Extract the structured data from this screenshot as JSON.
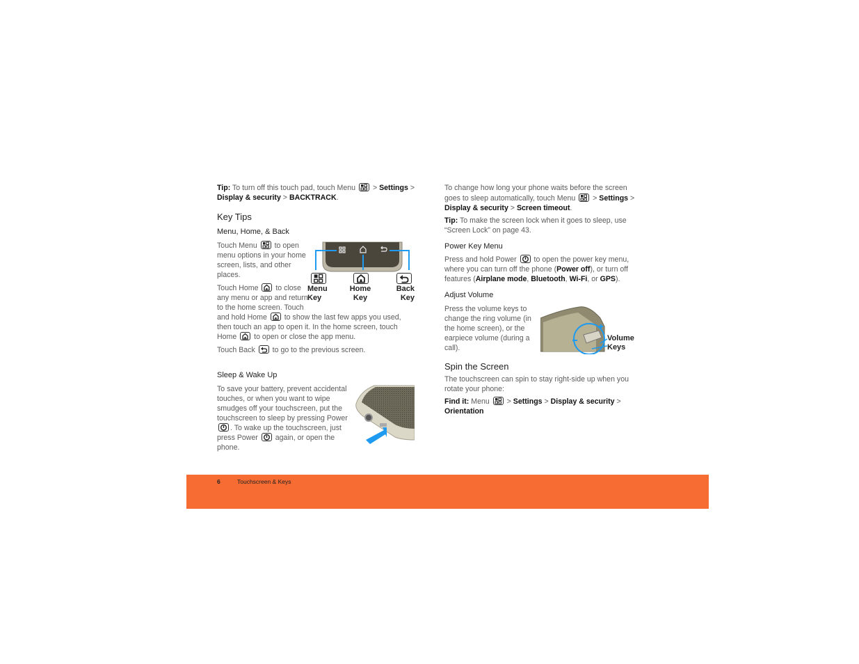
{
  "left": {
    "tip": [
      {
        "b": "Tip:"
      },
      {
        "t": " To turn off this touch pad, touch Menu "
      },
      {
        "i": "menu"
      },
      {
        "t": " > "
      },
      {
        "b": "Settings"
      },
      {
        "t": " > "
      },
      {
        "b": "Display & security"
      },
      {
        "t": " > "
      },
      {
        "b": "BACKTRACK"
      },
      {
        "t": "."
      }
    ],
    "heading": "Key Tips",
    "subheading1": "Menu, Home, & Back",
    "p1": [
      {
        "t": "Touch Menu "
      },
      {
        "i": "menu"
      },
      {
        "t": " to open menu options in your home screen, lists, and other places."
      }
    ],
    "p2": [
      {
        "t": "Touch Home "
      },
      {
        "i": "home"
      },
      {
        "t": " to close any menu or app and return to the home screen. Touch and hold Home "
      },
      {
        "i": "home"
      },
      {
        "t": " to show the last few apps you used, then touch an app to open it. In the home screen, touch Home "
      },
      {
        "i": "home"
      },
      {
        "t": " to open or close the app menu."
      }
    ],
    "p3": [
      {
        "t": "Touch Back "
      },
      {
        "i": "back"
      },
      {
        "t": " to go to the previous screen."
      }
    ],
    "keys_figure": {
      "menu_label": "Menu",
      "menu_label2": "Key",
      "home_label": "Home",
      "home_label2": "Key",
      "back_label": "Back",
      "back_label2": "Key"
    },
    "subheading2": "Sleep & Wake Up",
    "p4": [
      {
        "t": "To save your battery, prevent accidental touches, or when you want to wipe smudges off your touchscreen, put the touchscreen to sleep by pressing Power "
      },
      {
        "i": "power"
      },
      {
        "t": ". To wake up the touchscreen, just press Power "
      },
      {
        "i": "power"
      },
      {
        "t": " again, or open the phone."
      }
    ]
  },
  "right": {
    "p1": [
      {
        "t": "To change how long your phone waits before the screen goes to sleep automatically, touch Menu "
      },
      {
        "i": "menu"
      },
      {
        "t": " > "
      },
      {
        "b": "Settings"
      },
      {
        "t": " > "
      },
      {
        "b": "Display & security"
      },
      {
        "t": " > "
      },
      {
        "b": "Screen timeout"
      },
      {
        "t": "."
      }
    ],
    "tip": [
      {
        "b": "Tip:"
      },
      {
        "t": " To make the screen lock when it goes to sleep, use “Screen Lock” on page 43."
      }
    ],
    "subheading1": "Power Key Menu",
    "p2": [
      {
        "t": "Press and hold Power "
      },
      {
        "i": "power"
      },
      {
        "t": " to open the power key menu, where you can turn off the phone ("
      },
      {
        "b": "Power off"
      },
      {
        "t": "), or turn off features ("
      },
      {
        "b": "Airplane mode"
      },
      {
        "t": ", "
      },
      {
        "b": "Bluetooth"
      },
      {
        "t": ", "
      },
      {
        "b": "Wi-Fi"
      },
      {
        "t": ", or "
      },
      {
        "b": "GPS"
      },
      {
        "t": ")."
      }
    ],
    "subheading2": "Adjust Volume",
    "p3": [
      {
        "t": "Press the volume keys to change the ring volume (in the home screen), or the earpiece volume (during a call)."
      }
    ],
    "volume_figure": {
      "label1": "Volume",
      "label2": "Keys"
    },
    "heading": "Spin the Screen",
    "p4": [
      {
        "t": "The touchscreen can spin to stay right-side up when you rotate your phone:"
      }
    ],
    "p5": [
      {
        "b": "Find it:"
      },
      {
        "t": " Menu "
      },
      {
        "i": "menu"
      },
      {
        "t": " > "
      },
      {
        "b": "Settings"
      },
      {
        "t": " > "
      },
      {
        "b": "Display & security"
      },
      {
        "t": " > "
      },
      {
        "b": "Orientation"
      }
    ]
  },
  "footer": {
    "page_number": "6",
    "section": "Touchscreen & Keys"
  },
  "colors": {
    "footer": "#f76c32",
    "callout": "#1e9bf0"
  }
}
